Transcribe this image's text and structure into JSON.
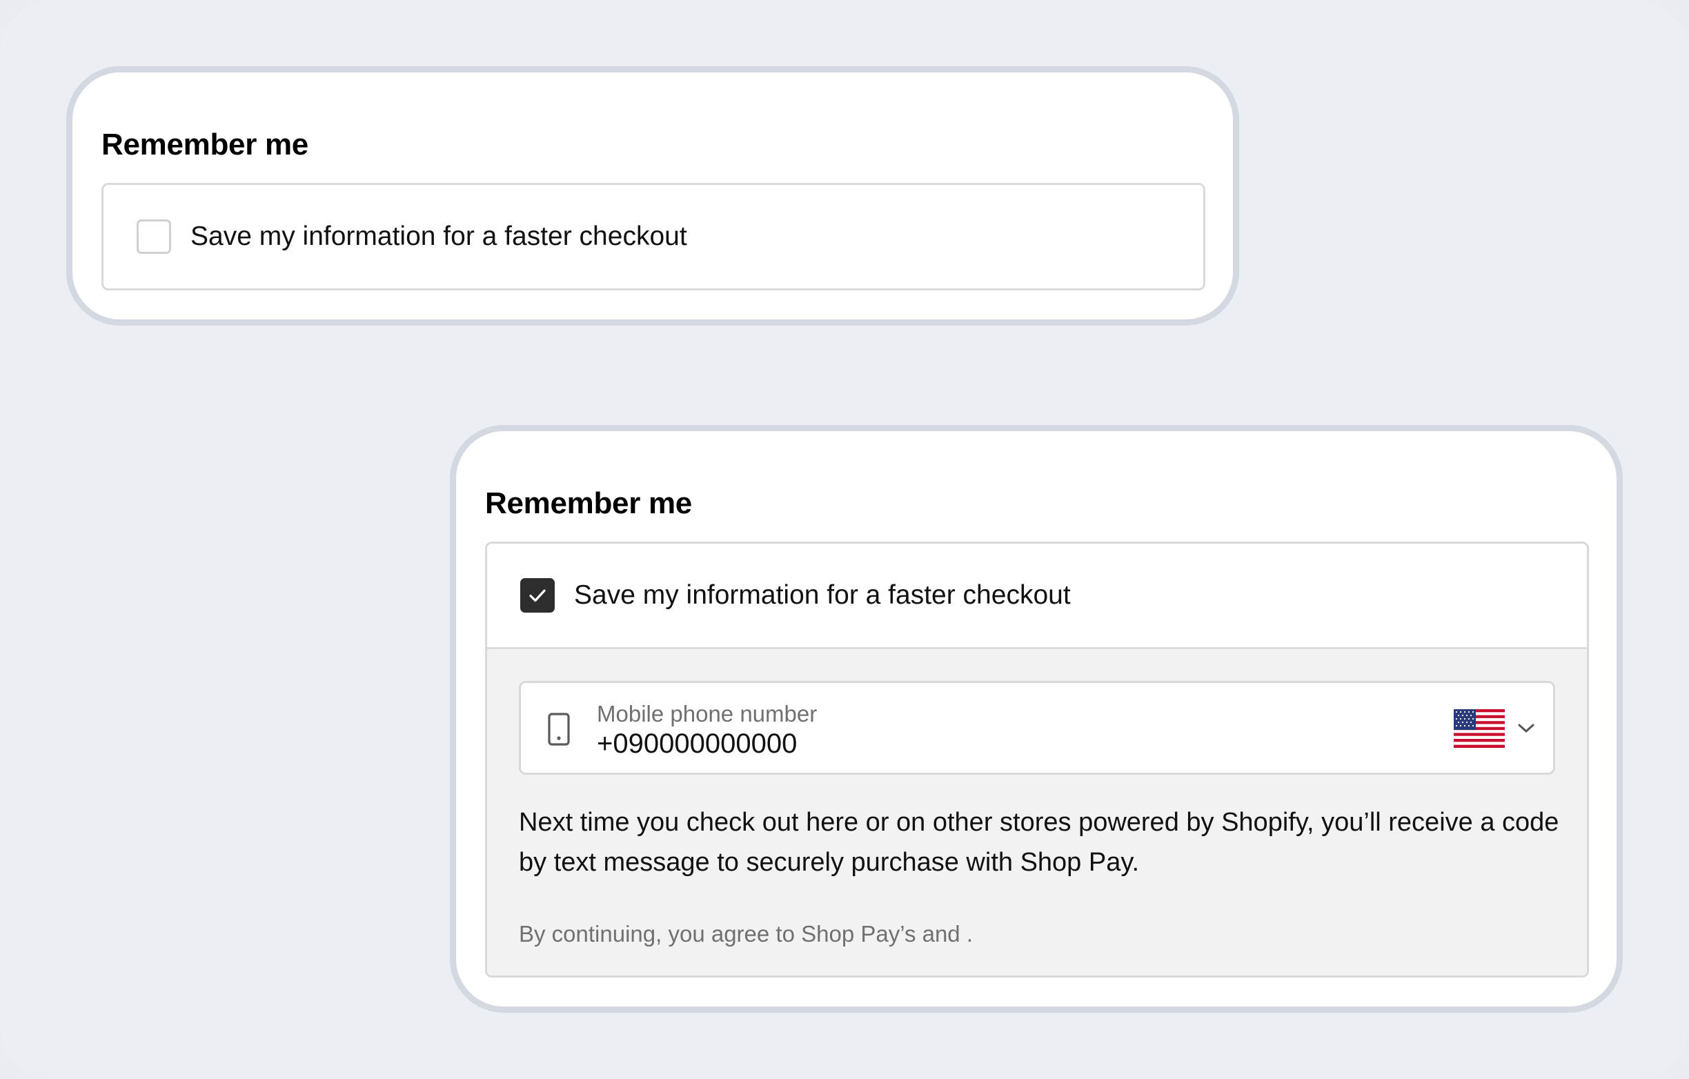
{
  "colors": {
    "page_background": "#ebeef3",
    "card_border": "#d3d8e1",
    "checkbox_checked": "#2d2d2d",
    "panel_background": "#f2f2f2",
    "muted_text": "#707070"
  },
  "unchecked_card": {
    "title": "Remember me",
    "checkbox": {
      "checked": false,
      "label": "Save my information for a faster checkout"
    }
  },
  "checked_card": {
    "title": "Remember me",
    "checkbox": {
      "checked": true,
      "label": "Save my information for a faster checkout"
    },
    "phone_field": {
      "label": "Mobile phone number",
      "value": "+090000000000",
      "country_icon": "us-flag-icon"
    },
    "info_text": "Next time you check out here or on other stores powered by Shopify, you’ll receive a code by text message to securely purchase with Shop Pay.",
    "legal_text": "By continuing, you agree to Shop Pay’s and ."
  }
}
